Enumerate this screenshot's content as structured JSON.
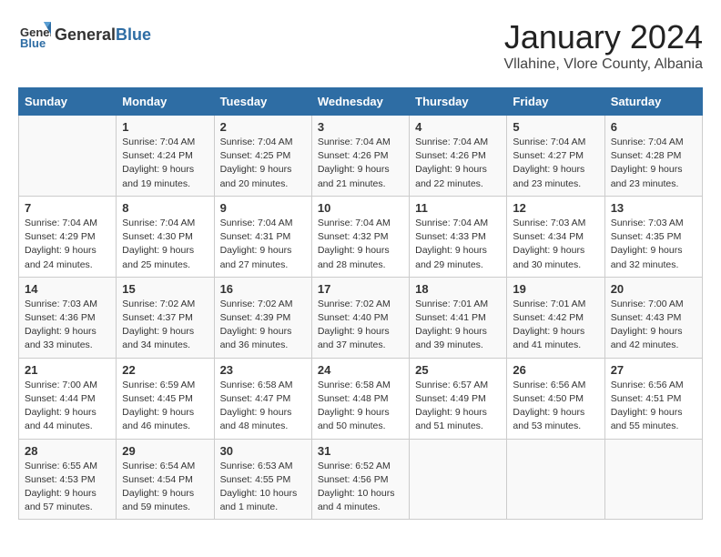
{
  "header": {
    "logo_general": "General",
    "logo_blue": "Blue",
    "month": "January 2024",
    "location": "Vllahine, Vlore County, Albania"
  },
  "weekdays": [
    "Sunday",
    "Monday",
    "Tuesday",
    "Wednesday",
    "Thursday",
    "Friday",
    "Saturday"
  ],
  "weeks": [
    [
      {
        "day": "",
        "info": ""
      },
      {
        "day": "1",
        "info": "Sunrise: 7:04 AM\nSunset: 4:24 PM\nDaylight: 9 hours\nand 19 minutes."
      },
      {
        "day": "2",
        "info": "Sunrise: 7:04 AM\nSunset: 4:25 PM\nDaylight: 9 hours\nand 20 minutes."
      },
      {
        "day": "3",
        "info": "Sunrise: 7:04 AM\nSunset: 4:26 PM\nDaylight: 9 hours\nand 21 minutes."
      },
      {
        "day": "4",
        "info": "Sunrise: 7:04 AM\nSunset: 4:26 PM\nDaylight: 9 hours\nand 22 minutes."
      },
      {
        "day": "5",
        "info": "Sunrise: 7:04 AM\nSunset: 4:27 PM\nDaylight: 9 hours\nand 23 minutes."
      },
      {
        "day": "6",
        "info": "Sunrise: 7:04 AM\nSunset: 4:28 PM\nDaylight: 9 hours\nand 23 minutes."
      }
    ],
    [
      {
        "day": "7",
        "info": "Sunrise: 7:04 AM\nSunset: 4:29 PM\nDaylight: 9 hours\nand 24 minutes."
      },
      {
        "day": "8",
        "info": "Sunrise: 7:04 AM\nSunset: 4:30 PM\nDaylight: 9 hours\nand 25 minutes."
      },
      {
        "day": "9",
        "info": "Sunrise: 7:04 AM\nSunset: 4:31 PM\nDaylight: 9 hours\nand 27 minutes."
      },
      {
        "day": "10",
        "info": "Sunrise: 7:04 AM\nSunset: 4:32 PM\nDaylight: 9 hours\nand 28 minutes."
      },
      {
        "day": "11",
        "info": "Sunrise: 7:04 AM\nSunset: 4:33 PM\nDaylight: 9 hours\nand 29 minutes."
      },
      {
        "day": "12",
        "info": "Sunrise: 7:03 AM\nSunset: 4:34 PM\nDaylight: 9 hours\nand 30 minutes."
      },
      {
        "day": "13",
        "info": "Sunrise: 7:03 AM\nSunset: 4:35 PM\nDaylight: 9 hours\nand 32 minutes."
      }
    ],
    [
      {
        "day": "14",
        "info": "Sunrise: 7:03 AM\nSunset: 4:36 PM\nDaylight: 9 hours\nand 33 minutes."
      },
      {
        "day": "15",
        "info": "Sunrise: 7:02 AM\nSunset: 4:37 PM\nDaylight: 9 hours\nand 34 minutes."
      },
      {
        "day": "16",
        "info": "Sunrise: 7:02 AM\nSunset: 4:39 PM\nDaylight: 9 hours\nand 36 minutes."
      },
      {
        "day": "17",
        "info": "Sunrise: 7:02 AM\nSunset: 4:40 PM\nDaylight: 9 hours\nand 37 minutes."
      },
      {
        "day": "18",
        "info": "Sunrise: 7:01 AM\nSunset: 4:41 PM\nDaylight: 9 hours\nand 39 minutes."
      },
      {
        "day": "19",
        "info": "Sunrise: 7:01 AM\nSunset: 4:42 PM\nDaylight: 9 hours\nand 41 minutes."
      },
      {
        "day": "20",
        "info": "Sunrise: 7:00 AM\nSunset: 4:43 PM\nDaylight: 9 hours\nand 42 minutes."
      }
    ],
    [
      {
        "day": "21",
        "info": "Sunrise: 7:00 AM\nSunset: 4:44 PM\nDaylight: 9 hours\nand 44 minutes."
      },
      {
        "day": "22",
        "info": "Sunrise: 6:59 AM\nSunset: 4:45 PM\nDaylight: 9 hours\nand 46 minutes."
      },
      {
        "day": "23",
        "info": "Sunrise: 6:58 AM\nSunset: 4:47 PM\nDaylight: 9 hours\nand 48 minutes."
      },
      {
        "day": "24",
        "info": "Sunrise: 6:58 AM\nSunset: 4:48 PM\nDaylight: 9 hours\nand 50 minutes."
      },
      {
        "day": "25",
        "info": "Sunrise: 6:57 AM\nSunset: 4:49 PM\nDaylight: 9 hours\nand 51 minutes."
      },
      {
        "day": "26",
        "info": "Sunrise: 6:56 AM\nSunset: 4:50 PM\nDaylight: 9 hours\nand 53 minutes."
      },
      {
        "day": "27",
        "info": "Sunrise: 6:56 AM\nSunset: 4:51 PM\nDaylight: 9 hours\nand 55 minutes."
      }
    ],
    [
      {
        "day": "28",
        "info": "Sunrise: 6:55 AM\nSunset: 4:53 PM\nDaylight: 9 hours\nand 57 minutes."
      },
      {
        "day": "29",
        "info": "Sunrise: 6:54 AM\nSunset: 4:54 PM\nDaylight: 9 hours\nand 59 minutes."
      },
      {
        "day": "30",
        "info": "Sunrise: 6:53 AM\nSunset: 4:55 PM\nDaylight: 10 hours\nand 1 minute."
      },
      {
        "day": "31",
        "info": "Sunrise: 6:52 AM\nSunset: 4:56 PM\nDaylight: 10 hours\nand 4 minutes."
      },
      {
        "day": "",
        "info": ""
      },
      {
        "day": "",
        "info": ""
      },
      {
        "day": "",
        "info": ""
      }
    ]
  ]
}
